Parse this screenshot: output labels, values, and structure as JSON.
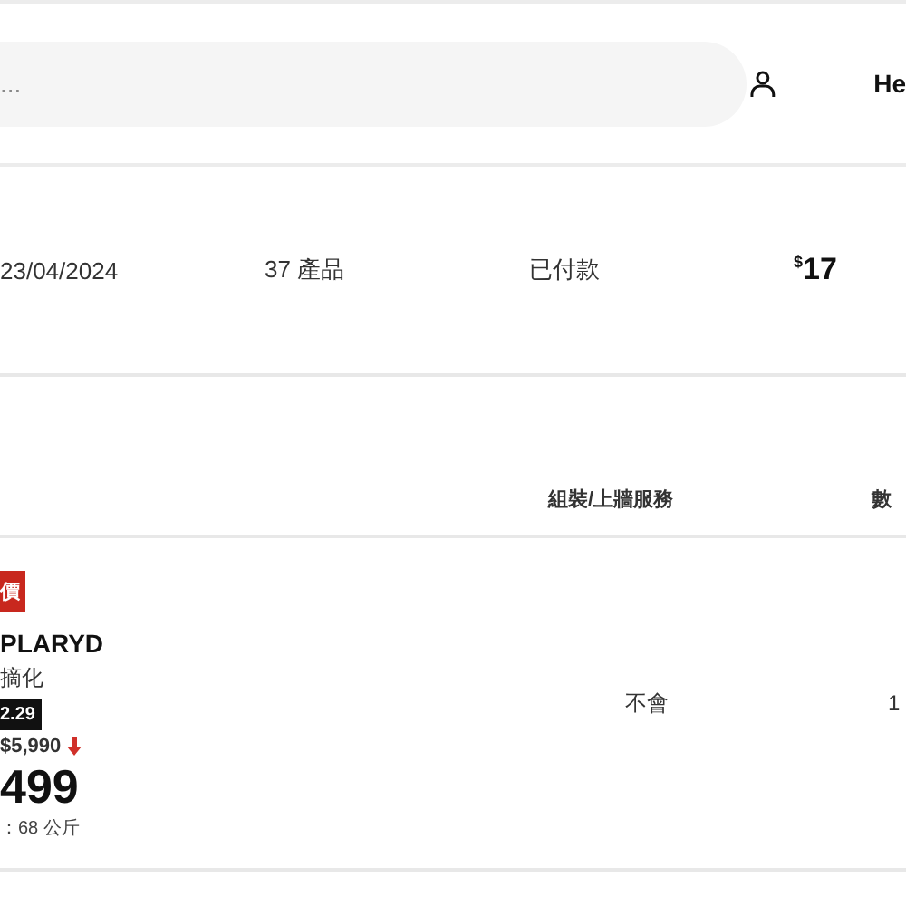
{
  "header": {
    "search": {
      "placeholder": "..."
    },
    "account": {
      "label": "He"
    }
  },
  "order": {
    "date": "23/04/2024",
    "items": "37 產品",
    "status": "已付款",
    "total": {
      "currency": "$",
      "amount": "17"
    }
  },
  "table": {
    "columns": [
      "組裝/上牆服務",
      "數"
    ],
    "rows": [
      {
        "badge": "價",
        "name": "PLARYD",
        "description": "摘化",
        "tag": "2.29",
        "previous_price": "$5,990",
        "price_dropped": true,
        "price": "499",
        "weight": "：68 公斤",
        "assembly": "不會",
        "quantity": "1"
      }
    ]
  }
}
